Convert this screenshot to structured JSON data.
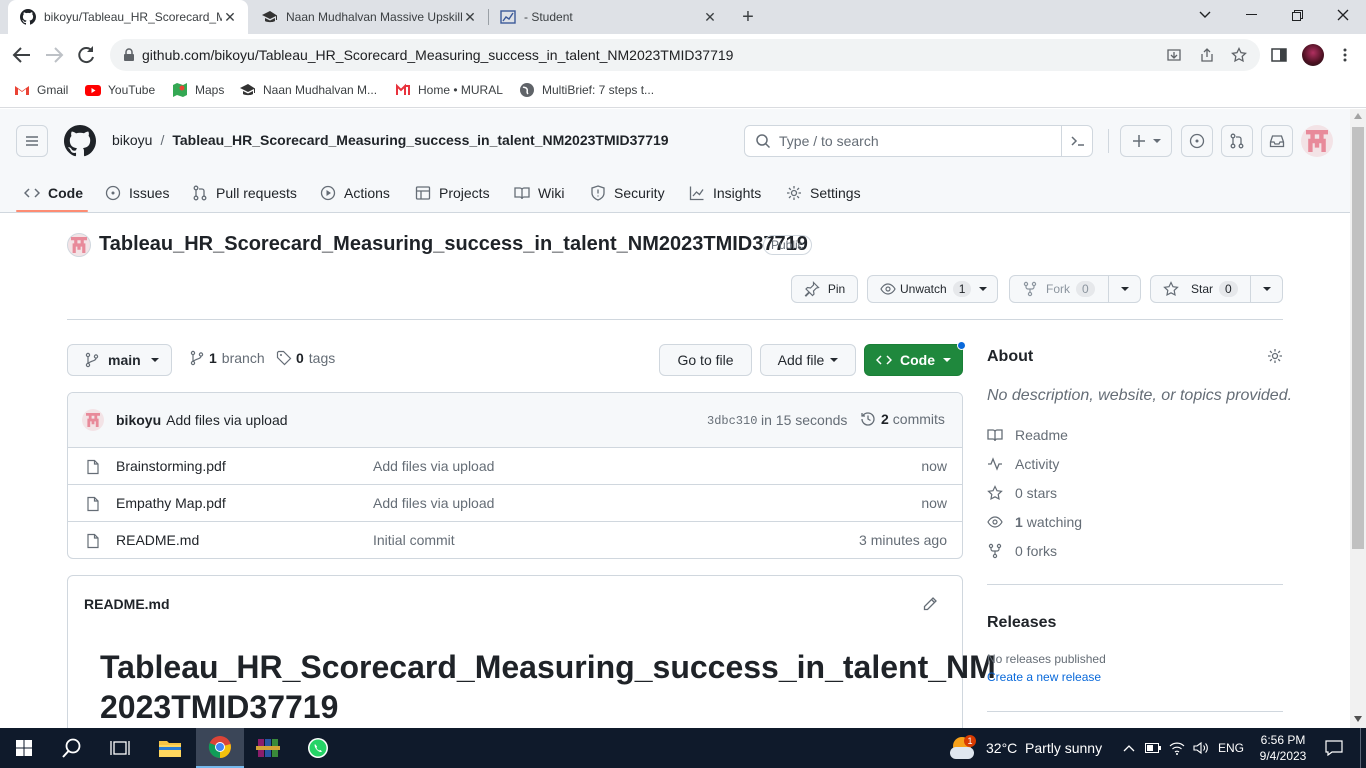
{
  "browser": {
    "tabs": [
      {
        "title": "bikoyu/Tableau_HR_Scorecard_M",
        "active": true
      },
      {
        "title": "Naan Mudhalvan Massive Upskill",
        "active": false
      },
      {
        "title": "- Student",
        "active": false
      }
    ],
    "url": "github.com/bikoyu/Tableau_HR_Scorecard_Measuring_success_in_talent_NM2023TMID37719",
    "bookmarks": [
      "Gmail",
      "YouTube",
      "Maps",
      "Naan Mudhalvan M...",
      "Home • MURAL",
      "MultiBrief: 7 steps t..."
    ]
  },
  "github": {
    "owner": "bikoyu",
    "separator": "/",
    "repo": "Tableau_HR_Scorecard_Measuring_success_in_talent_NM2023TMID37719",
    "search_placeholder": "Type / to search",
    "search_key": "/",
    "nav": [
      "Code",
      "Issues",
      "Pull requests",
      "Actions",
      "Projects",
      "Wiki",
      "Security",
      "Insights",
      "Settings"
    ],
    "repo_title": "Tableau_HR_Scorecard_Measuring_success_in_talent_NM2023TMID37719",
    "visibility": "Public",
    "actions": {
      "pin": "Pin",
      "unwatch": "Unwatch",
      "watch_count": "1",
      "fork": "Fork",
      "fork_count": "0",
      "star": "Star",
      "star_count": "0"
    },
    "branch": "main",
    "branch_count": "1",
    "branch_label": "branch",
    "tag_count": "0",
    "tag_label": "tags",
    "goto_file": "Go to file",
    "add_file": "Add file",
    "code_btn": "Code",
    "commit": {
      "author": "bikoyu",
      "message": "Add files via upload",
      "sha": "3dbc310",
      "time": "in 15 seconds",
      "count": "2",
      "count_label": "commits"
    },
    "files": [
      {
        "name": "Brainstorming.pdf",
        "message": "Add files via upload",
        "time": "now"
      },
      {
        "name": "Empathy Map.pdf",
        "message": "Add files via upload",
        "time": "now"
      },
      {
        "name": "README.md",
        "message": "Initial commit",
        "time": "3 minutes ago"
      }
    ],
    "readme": {
      "file": "README.md",
      "heading_line1": "Tableau_HR_Scorecard_Measuring_success_in_talent_NM",
      "heading_line2": "2023TMID37719"
    },
    "about": {
      "title": "About",
      "description": "No description, website, or topics provided.",
      "readme": "Readme",
      "activity": "Activity",
      "stars": "0 stars",
      "watching_count": "1",
      "watching": "watching",
      "forks": "0 forks"
    },
    "releases": {
      "title": "Releases",
      "none": "No releases published",
      "create": "Create a new release"
    }
  },
  "taskbar": {
    "weather": "32°C  Partly sunny",
    "weather_badge": "1",
    "lang": "ENG",
    "time": "6:56 PM",
    "date": "9/4/2023"
  },
  "colors": {
    "accent": "#1f883d",
    "link": "#0969da",
    "nav_underline": "#fd8c73"
  }
}
